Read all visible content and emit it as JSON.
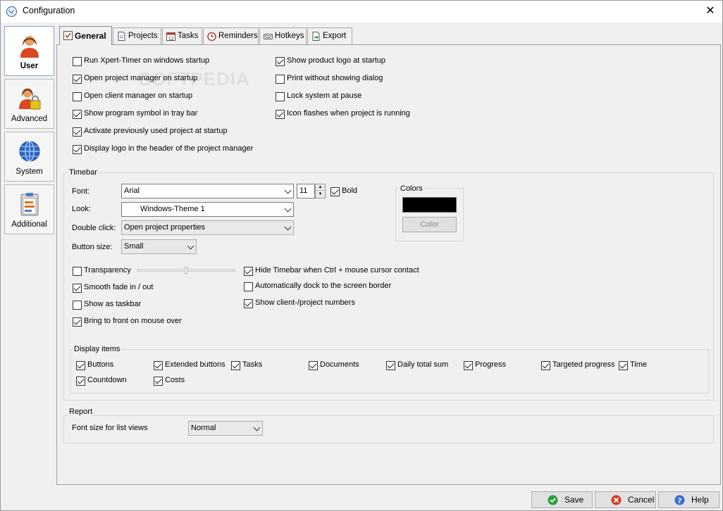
{
  "window": {
    "title": "Configuration",
    "close_glyph": "✕"
  },
  "sidebar": {
    "items": [
      {
        "label": "User",
        "icon": "user-icon"
      },
      {
        "label": "Advanced",
        "icon": "user-lock-icon"
      },
      {
        "label": "System",
        "icon": "globe-icon"
      },
      {
        "label": "Additional",
        "icon": "clipboard-icon"
      }
    ]
  },
  "tabs": [
    {
      "label": "General"
    },
    {
      "label": "Projects"
    },
    {
      "label": "Tasks"
    },
    {
      "label": "Reminders"
    },
    {
      "label": "Hotkeys"
    },
    {
      "label": "Export"
    }
  ],
  "general": {
    "left_options": [
      {
        "label": "Run Xpert-Timer on windows startup",
        "checked": false
      },
      {
        "label": "Open project manager on startup",
        "checked": true
      },
      {
        "label": "Open client manager on startup",
        "checked": false
      },
      {
        "label": "Show program symbol in tray bar",
        "checked": true
      },
      {
        "label": "Activate previously used project at startup",
        "checked": true
      },
      {
        "label": "Display logo in the header of the project manager",
        "checked": true
      }
    ],
    "right_options": [
      {
        "label": "Show product logo at startup",
        "checked": true
      },
      {
        "label": "Print without showing dialog",
        "checked": false
      },
      {
        "label": "Lock system at pause",
        "checked": false
      },
      {
        "label": "Icon flashes when project is running",
        "checked": true
      }
    ]
  },
  "timebar": {
    "title": "Timebar",
    "font_label": "Font:",
    "font_value": "Arial",
    "font_size": "11",
    "bold_label": "Bold",
    "bold_checked": true,
    "look_label": "Look:",
    "look_value": "Windows-Theme 1",
    "double_click_label": "Double click:",
    "double_click_value": "Open project properties",
    "button_size_label": "Button size:",
    "button_size_value": "Small",
    "colors_title": "Colors",
    "color_value": "#000000",
    "color_button": "Color",
    "transparency_level": 0.5,
    "left_options": [
      {
        "label": "Transparency",
        "checked": false
      },
      {
        "label": "Smooth fade in / out",
        "checked": true
      },
      {
        "label": "Show as taskbar",
        "checked": false
      },
      {
        "label": "Bring to front on mouse over",
        "checked": true
      }
    ],
    "right_options": [
      {
        "label": "Hide Timebar when Ctrl + mouse cursor contact",
        "checked": true
      },
      {
        "label": "Automatically dock to the screen border",
        "checked": false
      },
      {
        "label": "Show client-/project numbers",
        "checked": true
      }
    ]
  },
  "display_items": {
    "title": "Display items",
    "items": [
      {
        "label": "Buttons",
        "checked": true
      },
      {
        "label": "Extended buttons",
        "checked": true
      },
      {
        "label": "Tasks",
        "checked": true
      },
      {
        "label": "Documents",
        "checked": true
      },
      {
        "label": "Daily total sum",
        "checked": true
      },
      {
        "label": "Progress",
        "checked": true
      },
      {
        "label": "Targeted progress",
        "checked": true
      },
      {
        "label": "Time",
        "checked": true
      },
      {
        "label": "Countdown",
        "checked": true
      },
      {
        "label": "Costs",
        "checked": true
      }
    ]
  },
  "report": {
    "title": "Report",
    "font_size_label": "Font size for list views",
    "font_size_value": "Normal"
  },
  "buttons": {
    "save": "Save",
    "cancel": "Cancel",
    "help": "Help"
  },
  "watermark": "SOFTPEDIA",
  "colors": {
    "accent": "#2a5f9e",
    "save": "#2e9b3c",
    "cancel": "#d43a2a",
    "help": "#3a6fcf"
  }
}
